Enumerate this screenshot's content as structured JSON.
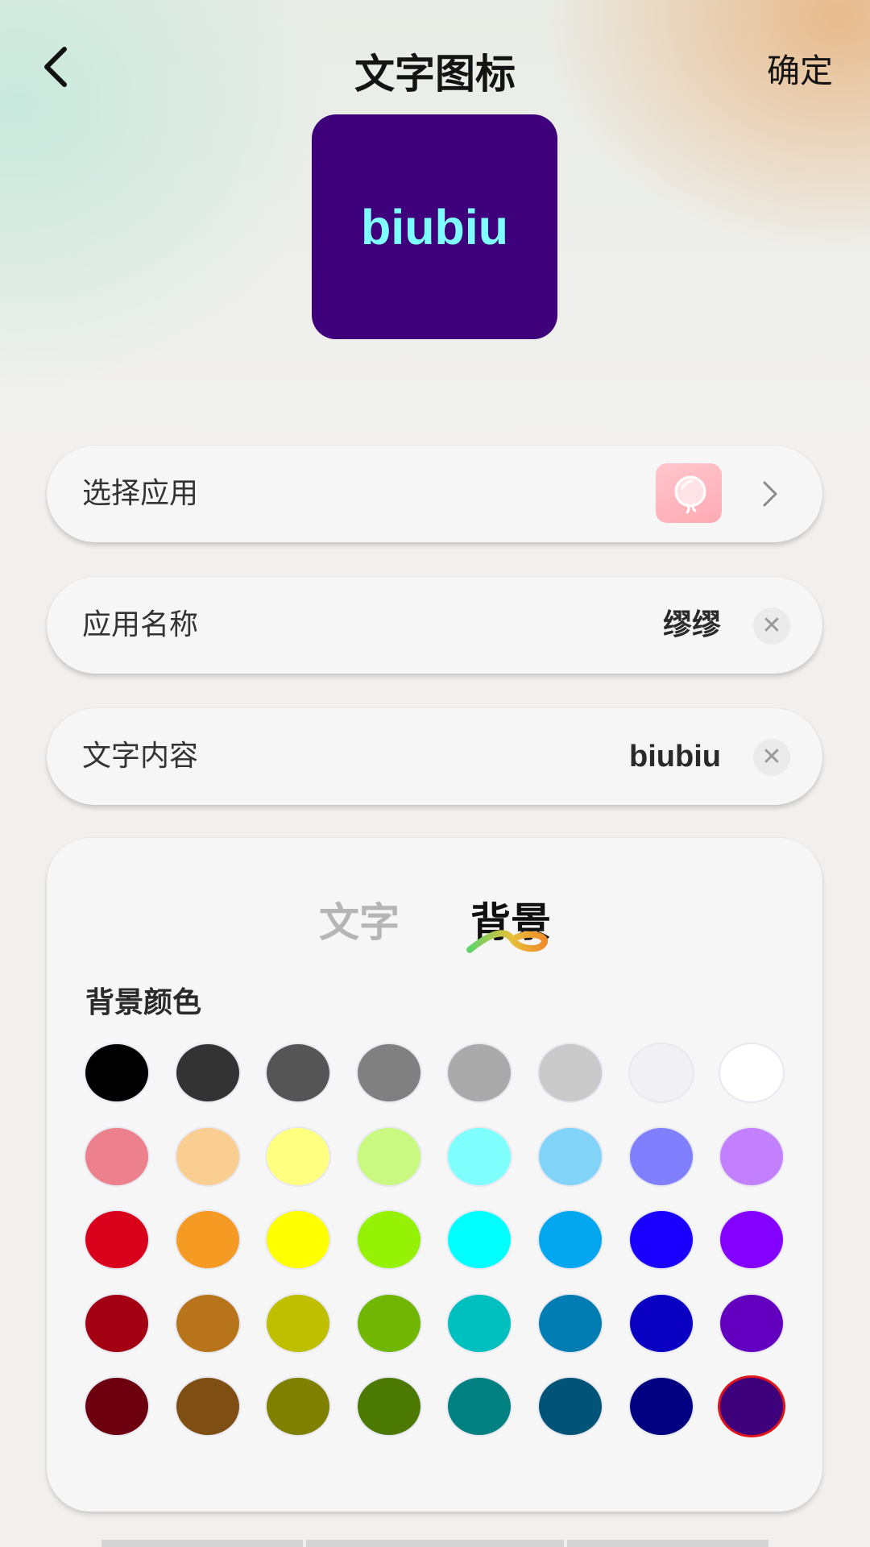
{
  "header": {
    "title": "文字图标",
    "confirm_label": "确定",
    "back_icon": "chevron-left-icon"
  },
  "preview": {
    "text": "biubiu",
    "background_color": "#3f007b",
    "text_color": "#7fffff"
  },
  "rows": {
    "select_app": {
      "label": "选择应用",
      "app_icon": "pink-mirror-app-icon",
      "chevron_icon": "chevron-right-icon"
    },
    "app_name": {
      "label": "应用名称",
      "value": "缪缪",
      "clear_icon": "clear-icon"
    },
    "text_content": {
      "label": "文字内容",
      "value": "biubiu",
      "clear_icon": "clear-icon"
    }
  },
  "panel": {
    "tabs": [
      {
        "label": "文字",
        "active": false
      },
      {
        "label": "背景",
        "active": true
      }
    ],
    "section_label": "背景颜色",
    "swatches": [
      [
        "#000000",
        "#333333",
        "#555555",
        "#808080",
        "#aaaaaa",
        "#cacaca",
        "#f1f1f3",
        "#ffffff"
      ],
      [
        "#ec808d",
        "#facd91",
        "#ffff80",
        "#caf982",
        "#80ffff",
        "#81d3f8",
        "#8080ff",
        "#c280ff"
      ],
      [
        "#d9001b",
        "#f59a23",
        "#ffff00",
        "#95f204",
        "#00ffff",
        "#02a7f0",
        "#1a00ff",
        "#8400ff"
      ],
      [
        "#a30014",
        "#b8741a",
        "#bfbf00",
        "#70b603",
        "#00bfbf",
        "#027db4",
        "#0a00c2",
        "#6300bf"
      ],
      [
        "#6d000e",
        "#7f4e12",
        "#808000",
        "#4b7902",
        "#008080",
        "#015478",
        "#000080",
        "#3f007b"
      ]
    ],
    "selected_color": "#3f007b",
    "selection_ring_color": "#e0151b"
  }
}
